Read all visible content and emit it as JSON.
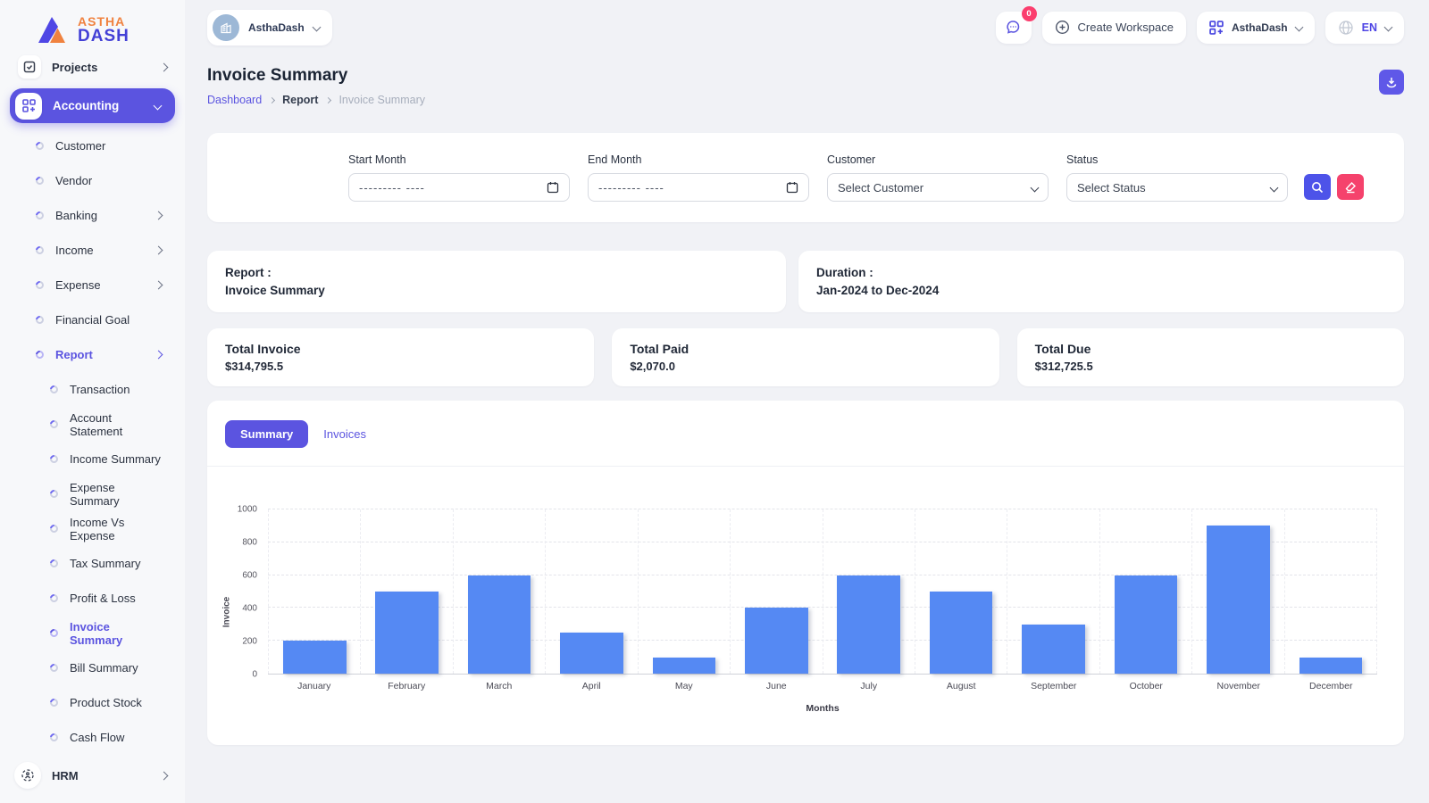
{
  "brand": {
    "line1": "ASTHA",
    "line2": "DASH"
  },
  "colors": {
    "accent": "#5b54e0",
    "bar": "#5589f3",
    "danger": "#f5426c",
    "badge": "#fb3e6e",
    "link": "#5b54e0"
  },
  "sidebar": {
    "projects_label": "Projects",
    "accounting_label": "Accounting",
    "accounting_items": [
      {
        "label": "Customer"
      },
      {
        "label": "Vendor"
      },
      {
        "label": "Banking",
        "chevron": true
      },
      {
        "label": "Income",
        "chevron": true
      },
      {
        "label": "Expense",
        "chevron": true
      },
      {
        "label": "Financial Goal"
      },
      {
        "label": "Report",
        "chevron": true,
        "active": true
      }
    ],
    "report_items": [
      {
        "label": "Transaction"
      },
      {
        "label": "Account Statement"
      },
      {
        "label": "Income Summary"
      },
      {
        "label": "Expense Summary"
      },
      {
        "label": "Income Vs Expense"
      },
      {
        "label": "Tax Summary"
      },
      {
        "label": "Profit & Loss"
      },
      {
        "label": "Invoice Summary",
        "active": true
      },
      {
        "label": "Bill Summary"
      },
      {
        "label": "Product Stock"
      },
      {
        "label": "Cash Flow"
      }
    ],
    "hrm_label": "HRM"
  },
  "header": {
    "workspace_pill": "AsthaDash",
    "chat_badge": "0",
    "create_workspace": "Create Workspace",
    "workspace_button": "AsthaDash",
    "language": "EN"
  },
  "page": {
    "title": "Invoice Summary",
    "breadcrumb": [
      "Dashboard",
      "Report",
      "Invoice Summary"
    ]
  },
  "filters": {
    "start_month": {
      "label": "Start Month",
      "placeholder": "--------- ----"
    },
    "end_month": {
      "label": "End Month",
      "placeholder": "--------- ----"
    },
    "customer": {
      "label": "Customer",
      "value": "Select Customer"
    },
    "status": {
      "label": "Status",
      "value": "Select Status"
    }
  },
  "report_card": {
    "label": "Report :",
    "value": "Invoice Summary"
  },
  "duration_card": {
    "label": "Duration :",
    "value": "Jan-2024 to Dec-2024"
  },
  "totals": [
    {
      "label": "Total Invoice",
      "value": "$314,795.5"
    },
    {
      "label": "Total Paid",
      "value": "$2,070.0"
    },
    {
      "label": "Total Due",
      "value": "$312,725.5"
    }
  ],
  "tabs": {
    "summary": "Summary",
    "invoices": "Invoices"
  },
  "chart_data": {
    "type": "bar",
    "title": "",
    "categories": [
      "January",
      "February",
      "March",
      "April",
      "May",
      "June",
      "July",
      "August",
      "September",
      "October",
      "November",
      "December"
    ],
    "values": [
      200,
      500,
      600,
      250,
      100,
      400,
      600,
      500,
      300,
      600,
      900,
      100
    ],
    "xlabel": "Months",
    "ylabel": "Invoice",
    "ylim": [
      0,
      1000
    ],
    "ytick_step": 200,
    "bar_color": "#5589f3",
    "grid": true,
    "legend": false
  }
}
